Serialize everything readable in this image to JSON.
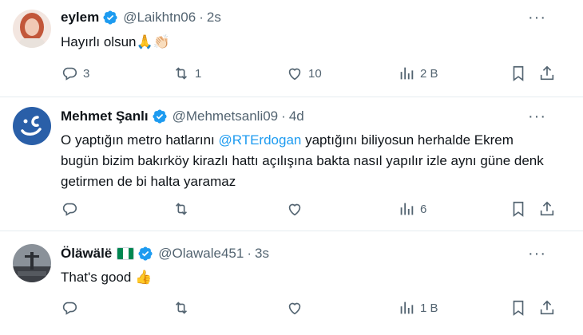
{
  "tweets": [
    {
      "name": "eylem",
      "handle": "@Laikhtn06",
      "separator": "·",
      "time": "2s",
      "text": "Hayırlı olsun",
      "emojis": "🙏👏🏻",
      "replies": "3",
      "retweets": "1",
      "likes": "10",
      "views": "2 B"
    },
    {
      "name": "Mehmet Şanlı",
      "handle": "@Mehmetsanli09",
      "separator": "·",
      "time": "4d",
      "text_before": "O yaptığın metro hatlarını ",
      "mention": "@RTErdogan",
      "text_after": " yaptığını biliyosun herhalde Ekrem bugün bizim bakırköy kirazlı hattı açılışına bakta nasıl yapılır izle aynı güne denk getirmen de bi halta yaramaz",
      "replies": "",
      "retweets": "",
      "likes": "",
      "views": "6"
    },
    {
      "name": "Öläwälë",
      "handle": "@Olawale451",
      "separator": "·",
      "time": "3s",
      "text": "That's good",
      "emojis": "👍",
      "replies": "",
      "retweets": "",
      "likes": "",
      "views": "1 B"
    }
  ],
  "more_label": "···",
  "colors": {
    "accent": "#1d9bf0",
    "muted": "#536471",
    "flag_green": "#008751"
  },
  "icons": [
    "reply-icon",
    "retweet-icon",
    "like-icon",
    "views-icon",
    "bookmark-icon",
    "share-icon",
    "verified-badge-icon",
    "more-icon"
  ]
}
